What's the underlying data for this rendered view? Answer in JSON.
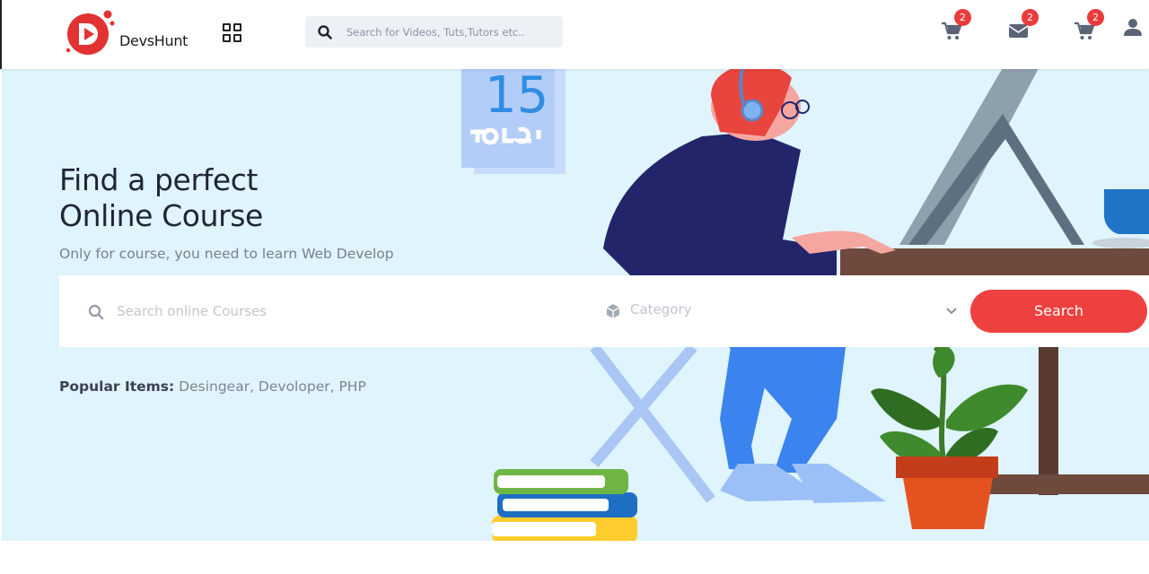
{
  "header": {
    "brand": "DevsHunt",
    "search_placeholder": "Search for Videos, Tuts,Tutors etc..",
    "cart_badge": "2",
    "messages_badge": "2",
    "cart2_badge": "2"
  },
  "hero": {
    "title_line1": "Find a perfect",
    "title_line2": "Online Course",
    "subtitle": "Only for course, you need to learn Web Develop",
    "search_placeholder": "Search online Courses",
    "category_label": "Category",
    "search_button": "Search",
    "popular_label": "Popular Items:",
    "popular_values": "Desingear, Devoloper, PHP",
    "calendar_number": "15"
  },
  "colors": {
    "accent": "#ef4040",
    "hero_bg": "#dff4fd"
  }
}
